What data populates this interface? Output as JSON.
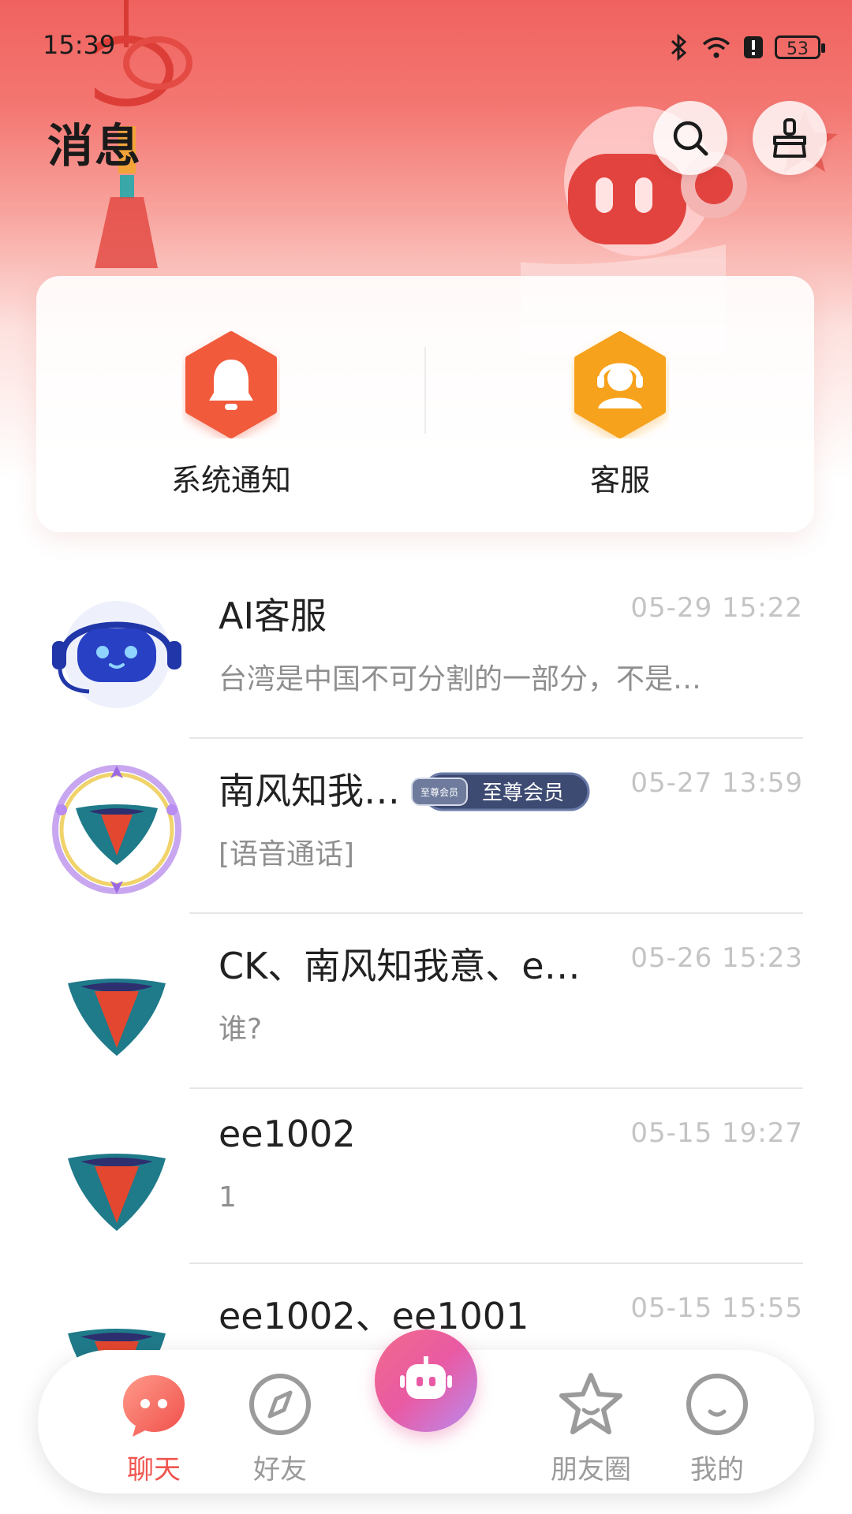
{
  "status_bar": {
    "time": "15:39",
    "battery": "53"
  },
  "header": {
    "title": "消息"
  },
  "quick_actions": [
    {
      "label": "系统通知",
      "icon": "bell-icon",
      "color": "#f15a3a"
    },
    {
      "label": "客服",
      "icon": "headset-agent-icon",
      "color": "#f7a21b"
    }
  ],
  "messages": [
    {
      "name": "AI客服",
      "time": "05-29 15:22",
      "preview": "台湾是中国不可分割的一部分，不是…",
      "avatar": "robot-avatar"
    },
    {
      "name": "南风知我…",
      "badge": "至尊会员",
      "time": "05-27 13:59",
      "preview": "[语音通话]",
      "avatar": "framed-logo-avatar"
    },
    {
      "name": "CK、南风知我意、e…",
      "time": "05-26 15:23",
      "preview": "谁?",
      "avatar": "logo-avatar"
    },
    {
      "name": "ee1002",
      "time": "05-15 19:27",
      "preview": "1",
      "avatar": "logo-avatar"
    },
    {
      "name": "ee1002、ee1001",
      "time": "05-15 15:55",
      "preview": "",
      "avatar": "logo-avatar"
    }
  ],
  "badge_seal_text": "至尊会员",
  "tabs": [
    {
      "label": "聊天",
      "icon": "chat-icon",
      "active": true
    },
    {
      "label": "好友",
      "icon": "compass-icon",
      "active": false
    },
    {
      "label": "",
      "icon": "robot-icon",
      "active": false
    },
    {
      "label": "朋友圈",
      "icon": "star-icon",
      "active": false
    },
    {
      "label": "我的",
      "icon": "smile-face-icon",
      "active": false
    }
  ],
  "colors": {
    "accent": "#f0554f",
    "header_gradient_top": "#f0625f"
  }
}
